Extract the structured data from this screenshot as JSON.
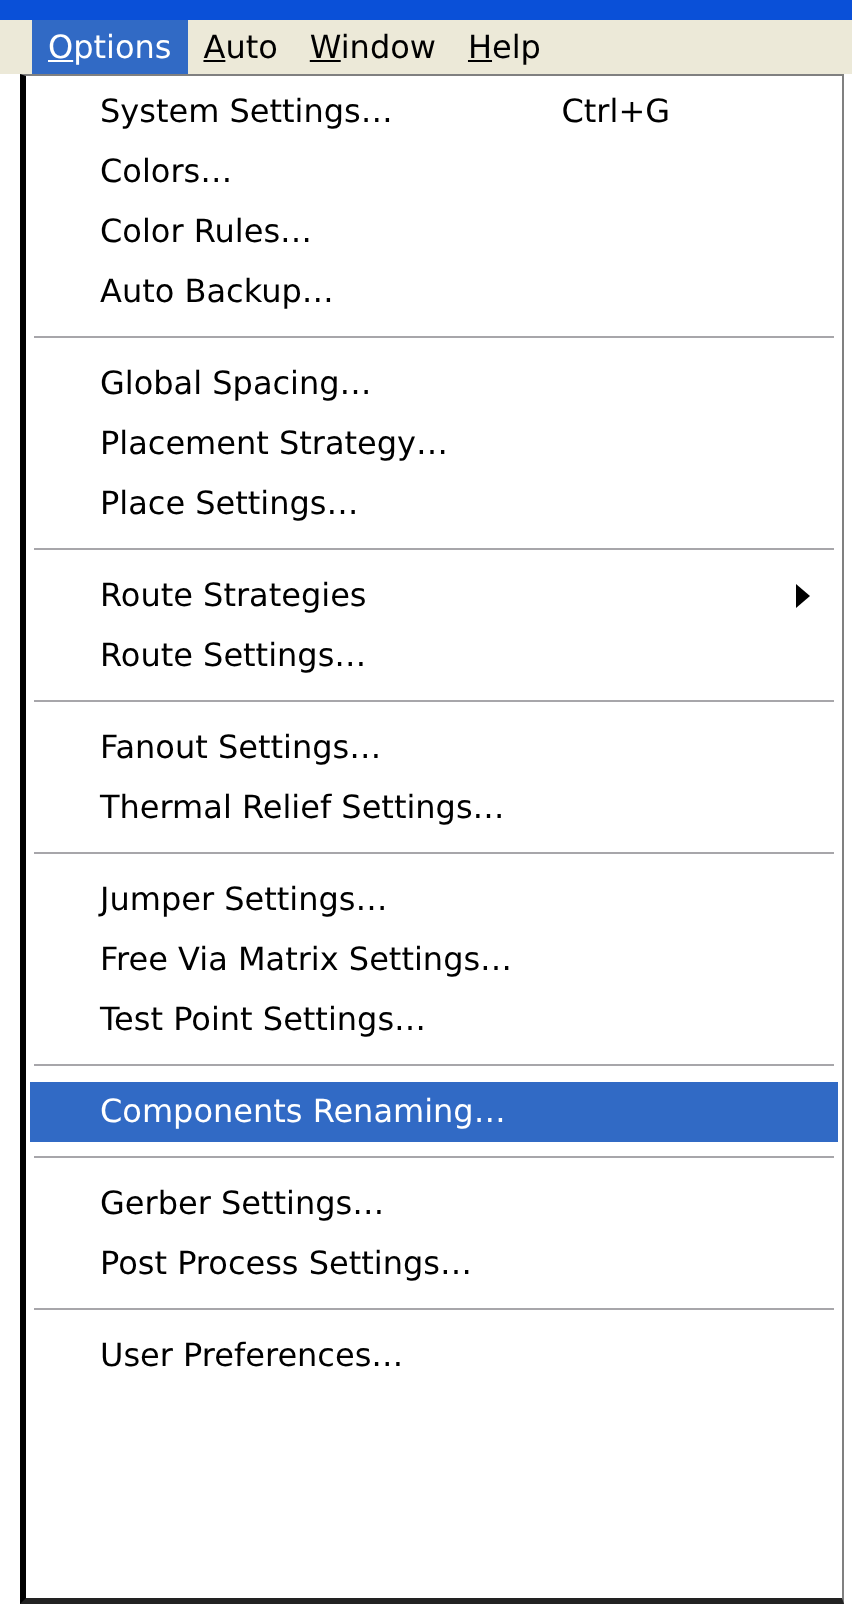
{
  "menu_bar": {
    "items": [
      {
        "label": "Options",
        "selected": true,
        "mnemonic_underlined": true
      },
      {
        "label": "Auto",
        "selected": false,
        "mnemonic_underlined": true
      },
      {
        "label": "Window",
        "selected": false,
        "mnemonic_underlined": true
      },
      {
        "label": "Help",
        "selected": false,
        "mnemonic_underlined": true
      }
    ]
  },
  "menu": {
    "sections": [
      [
        {
          "label": "System Settings…",
          "shortcut": "Ctrl+G",
          "has_submenu": false,
          "selected": false
        },
        {
          "label": "Colors…",
          "has_submenu": false,
          "selected": false
        },
        {
          "label": "Color Rules…",
          "has_submenu": false,
          "selected": false
        },
        {
          "label": "Auto Backup…",
          "has_submenu": false,
          "selected": false
        }
      ],
      [
        {
          "label": "Global Spacing…",
          "has_submenu": false,
          "selected": false
        },
        {
          "label": "Placement Strategy…",
          "has_submenu": false,
          "selected": false
        },
        {
          "label": "Place Settings…",
          "has_submenu": false,
          "selected": false
        }
      ],
      [
        {
          "label": "Route Strategies",
          "has_submenu": true,
          "selected": false
        },
        {
          "label": "Route Settings…",
          "has_submenu": false,
          "selected": false
        }
      ],
      [
        {
          "label": "Fanout Settings…",
          "has_submenu": false,
          "selected": false
        },
        {
          "label": "Thermal Relief Settings…",
          "has_submenu": false,
          "selected": false
        }
      ],
      [
        {
          "label": "Jumper Settings…",
          "has_submenu": false,
          "selected": false
        },
        {
          "label": "Free Via Matrix Settings…",
          "has_submenu": false,
          "selected": false
        },
        {
          "label": "Test Point Settings…",
          "has_submenu": false,
          "selected": false
        }
      ],
      [
        {
          "label": "Components Renaming…",
          "has_submenu": false,
          "selected": true
        }
      ],
      [
        {
          "label": "Gerber Settings…",
          "has_submenu": false,
          "selected": false
        },
        {
          "label": "Post Process Settings…",
          "has_submenu": false,
          "selected": false
        }
      ],
      [
        {
          "label": "User Preferences…",
          "has_submenu": false,
          "selected": false
        }
      ]
    ]
  }
}
